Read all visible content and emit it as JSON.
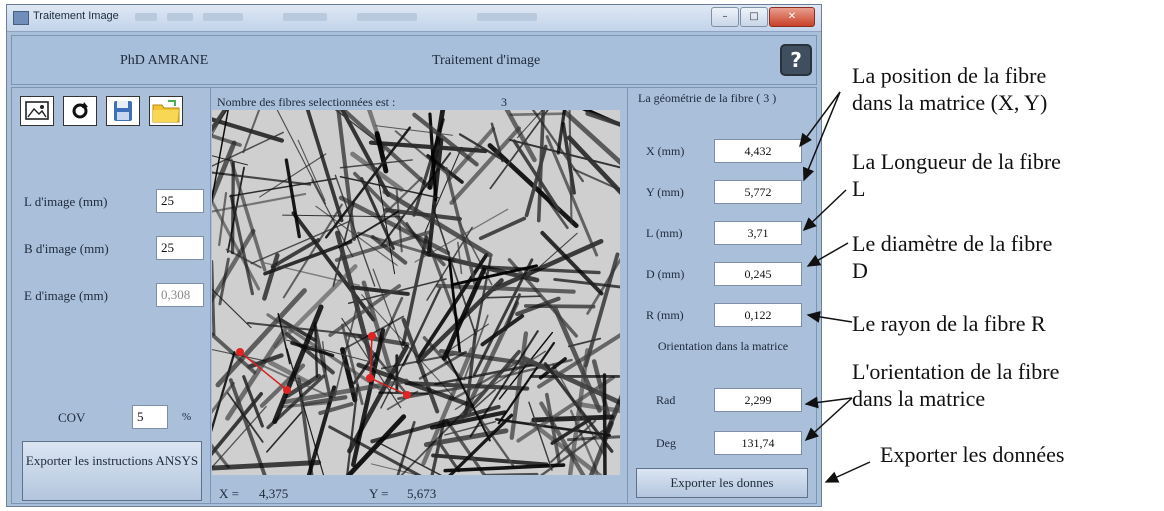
{
  "window": {
    "title": "Traitement Image",
    "controls": {
      "minimize": "–",
      "maximize": "□",
      "close": "✕"
    }
  },
  "header": {
    "author": "PhD AMRANE",
    "title": "Traitement d'image",
    "help_label": "?"
  },
  "toolbar": {
    "icons": [
      "image-icon",
      "refresh-icon",
      "save-icon",
      "folder-icon"
    ]
  },
  "left_panel": {
    "fields": [
      {
        "label": "L d'image (mm)",
        "value": "25"
      },
      {
        "label": "B d'image (mm)",
        "value": "25"
      },
      {
        "label": "E d'image (mm)",
        "value": "0,308"
      }
    ],
    "cov": {
      "label": "COV",
      "value": "5",
      "unit": "%"
    },
    "export_button": "Exporter les instructions ANSYS"
  },
  "center": {
    "count_label": "Nombre des fibres selectionnées est :",
    "count_value": "3",
    "x_label": "X =",
    "x_value": "4,375",
    "y_label": "Y =",
    "y_value": "5,673"
  },
  "right_panel": {
    "group_title": "La géométrie de la fibre ( 3 )",
    "fields": [
      {
        "label": "X (mm)",
        "value": "4,432"
      },
      {
        "label": "Y (mm)",
        "value": "5,772"
      },
      {
        "label": "L (mm)",
        "value": "3,71"
      },
      {
        "label": "D (mm)",
        "value": "0,245"
      },
      {
        "label": "R (mm)",
        "value": "0,122"
      }
    ],
    "orientation_title": "Orientation dans la matrice",
    "orientation_fields": [
      {
        "label": "Rad",
        "value": "2,299"
      },
      {
        "label": "Deg",
        "value": "131,74"
      }
    ],
    "export_button": "Exporter les donnes"
  },
  "annotations": {
    "position_line1": "La position de la fibre",
    "position_line2": "dans la matrice (X, Y)",
    "length_line1": "La Longueur de la fibre",
    "length_line2": "L",
    "diameter_line1": "Le diamètre de la fibre",
    "diameter_line2": "D",
    "radius": "Le rayon de la fibre R",
    "orientation_line1": "L'orientation de la fibre",
    "orientation_line2": "dans la matrice",
    "export": "Exporter les données"
  }
}
